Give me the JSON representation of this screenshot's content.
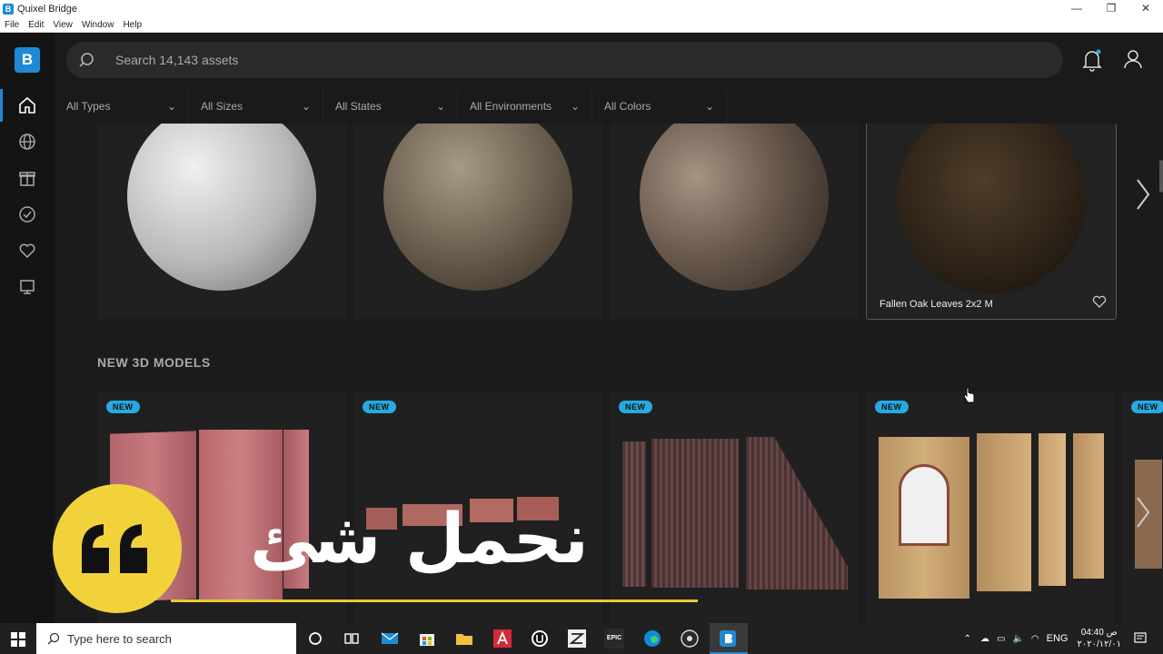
{
  "window": {
    "title": "Quixel Bridge",
    "app_icon_letter": "B"
  },
  "window_controls": {
    "minimize": "—",
    "restore": "❐",
    "close": "✕"
  },
  "menu": [
    "File",
    "Edit",
    "View",
    "Window",
    "Help"
  ],
  "logo_letter": "B",
  "search": {
    "placeholder": "Search 14,143 assets"
  },
  "filters": [
    "All Types",
    "All Sizes",
    "All States",
    "All Environments",
    "All Colors"
  ],
  "surfaces": [
    {
      "label": ""
    },
    {
      "label": ""
    },
    {
      "label": ""
    },
    {
      "label": "Fallen Oak Leaves 2x2 M"
    }
  ],
  "section_title": "NEW 3D MODELS",
  "new_badge": "NEW",
  "badge_partial": "NEW",
  "overlay": {
    "arabic_text": "نحمل شئ"
  },
  "taskbar": {
    "search_placeholder": "Type here to search",
    "language": "ENG",
    "time": "04:40 ص",
    "date": "٢٠٢٠/١٢/٠١",
    "icons": [
      "cortana-icon",
      "task-view-icon",
      "mail-icon",
      "store-icon",
      "file-explorer-icon",
      "autodesk-icon",
      "unreal-icon",
      "zbrush-icon",
      "epic-games-icon",
      "edge-icon",
      "obs-icon",
      "bridge-icon"
    ],
    "epic_label": "EPIC"
  },
  "colors": {
    "accent": "#1e8ad6",
    "badge": "#27a9e1",
    "overlay_yellow": "#f2d23a"
  }
}
